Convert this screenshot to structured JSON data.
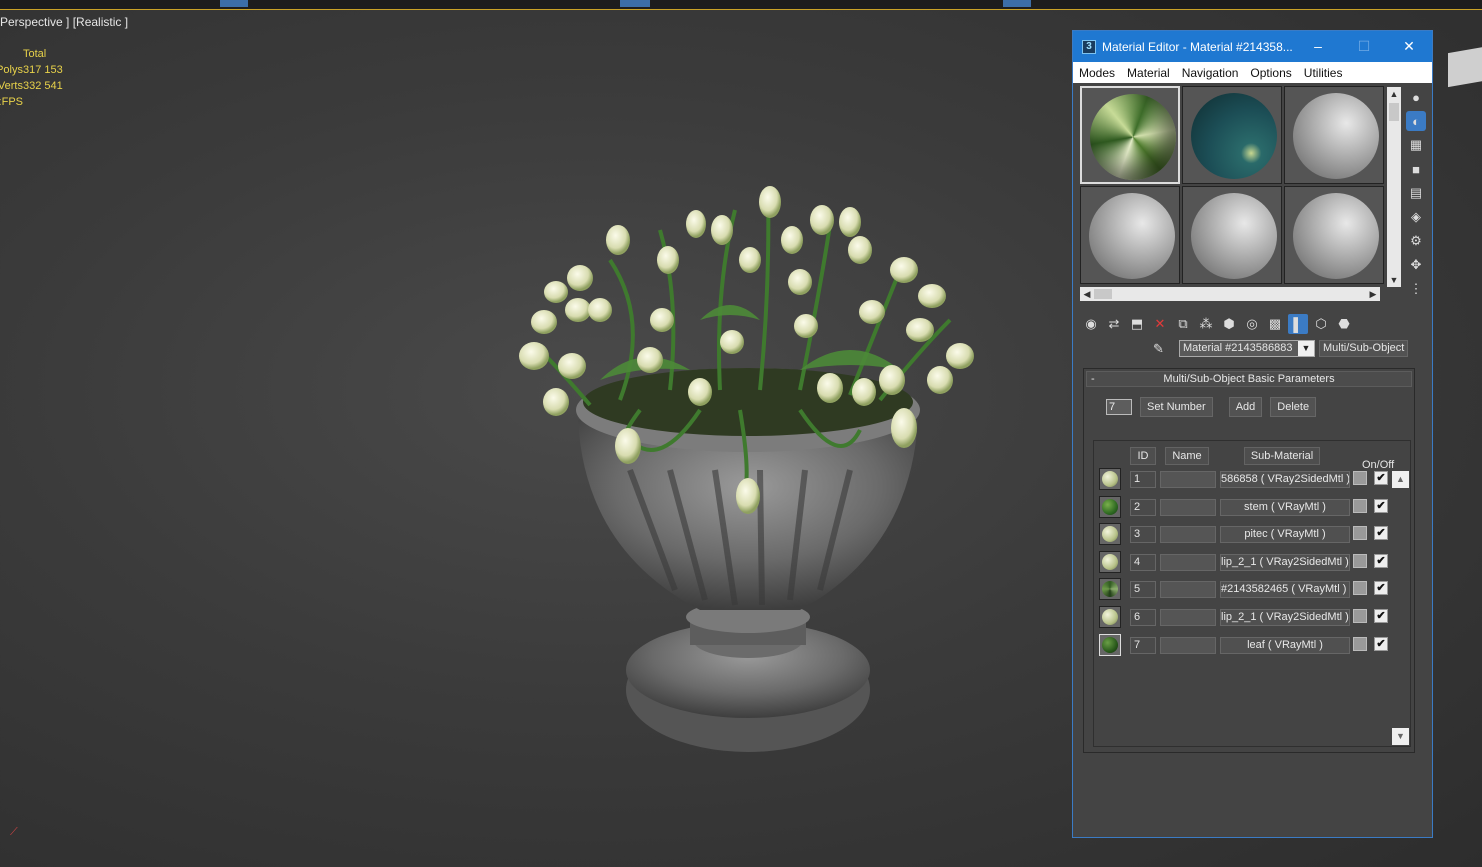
{
  "viewport": {
    "label": "Perspective ] [Realistic ]",
    "stats": {
      "header": "Total",
      "rows": [
        {
          "key": "Polys:",
          "value": "317 153"
        },
        {
          "key": "Verts:",
          "value": "332 541"
        },
        {
          "key": "FPS:",
          "value": ""
        }
      ]
    }
  },
  "material_editor": {
    "title": "Material Editor - Material #214358...",
    "window_controls": {
      "minimize": "–",
      "maximize": "☐",
      "close": "✕"
    },
    "menu": [
      "Modes",
      "Material",
      "Navigation",
      "Options",
      "Utilities"
    ],
    "material_name": "Material #2143586883",
    "material_type": "Multi/Sub-Object",
    "rollout_title": "Multi/Sub-Object Basic Parameters",
    "rollout_toggle": "-",
    "set_number_value": "7",
    "buttons": {
      "set_number": "Set Number",
      "add": "Add",
      "delete": "Delete"
    },
    "columns": {
      "id": "ID",
      "name": "Name",
      "sub_material": "Sub-Material",
      "on_off": "On/Off"
    },
    "rows": [
      {
        "id": "1",
        "sub": "586858 ( VRay2SidedMtl )",
        "checked": "✔",
        "ball": "light"
      },
      {
        "id": "2",
        "sub": "stem ( VRayMtl )",
        "checked": "✔",
        "ball": "dark"
      },
      {
        "id": "3",
        "sub": "pitec ( VRayMtl )",
        "checked": "✔",
        "ball": "light"
      },
      {
        "id": "4",
        "sub": "lip_2_1 ( VRay2SidedMtl )",
        "checked": "✔",
        "ball": "light"
      },
      {
        "id": "5",
        "sub": "#2143582465 ( VRayMtl )",
        "checked": "✔",
        "ball": "mid"
      },
      {
        "id": "6",
        "sub": "lip_2_1 ( VRay2SidedMtl )",
        "checked": "✔",
        "ball": "light"
      },
      {
        "id": "7",
        "sub": "leaf ( VRayMtl )",
        "checked": "✔",
        "ball": "dark"
      }
    ],
    "colors": {
      "title_bar": "#1f78d1",
      "accent": "#3b7bc4"
    }
  }
}
